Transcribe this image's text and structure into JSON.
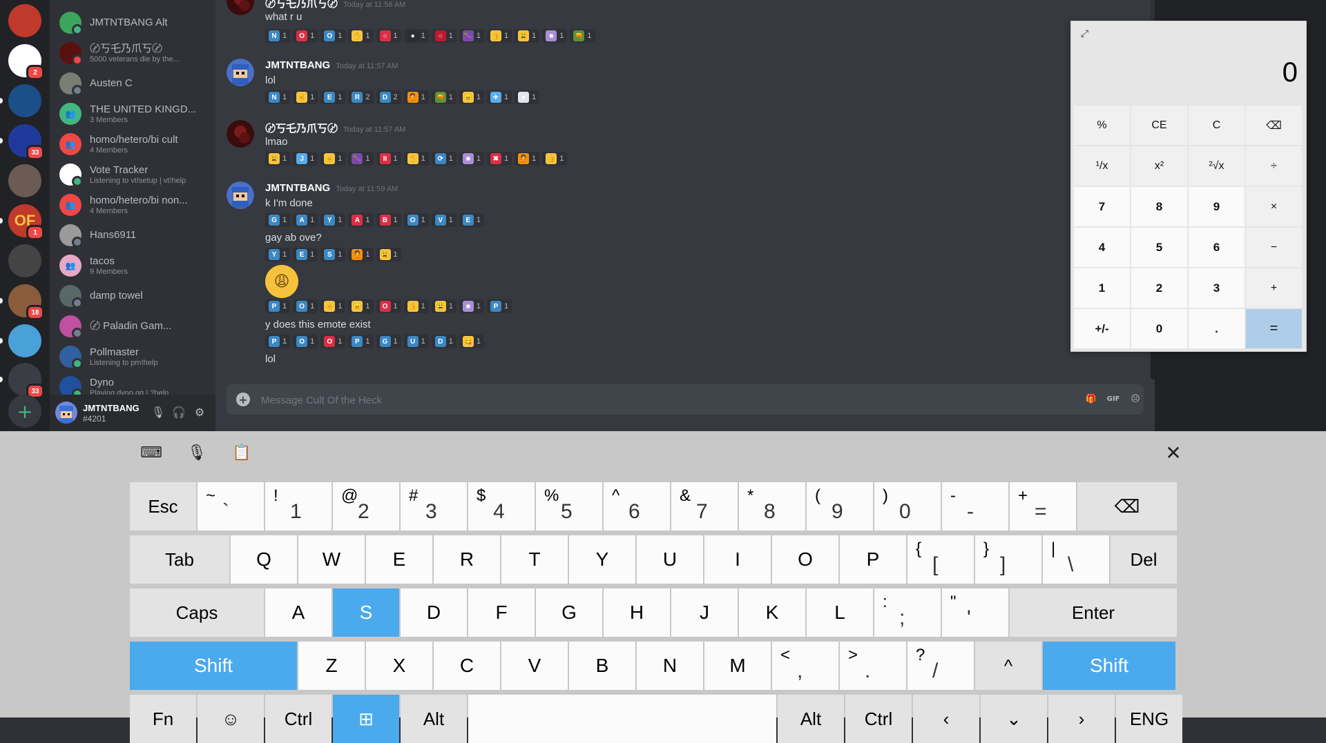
{
  "colors": {
    "accent": "#4ba9ee",
    "discord_dark": "#202225",
    "chat_bg": "#36393f",
    "online": "#43b581",
    "dnd": "#f04747",
    "idle": "#faa61a"
  },
  "rail": {
    "servers": [
      {
        "name": "server-1",
        "color": "#c0392b",
        "badge": ""
      },
      {
        "name": "server-2",
        "color": "#ffffff",
        "badge": "2"
      },
      {
        "name": "rocket-league",
        "color": "#1b4f8a",
        "badge": ""
      },
      {
        "name": "server-galaxy",
        "color": "#203a9c",
        "badge": "33"
      },
      {
        "name": "server-dog",
        "color": "#6b5b52",
        "badge": ""
      },
      {
        "name": "of-server",
        "color": "#c0392b",
        "badge": "1",
        "label": "OF"
      },
      {
        "name": "server-gear",
        "color": "#444444",
        "badge": ""
      },
      {
        "name": "server-face",
        "color": "#8a5c3c",
        "badge": "18"
      },
      {
        "name": "server-gem",
        "color": "#4aa0d8",
        "badge": ""
      },
      {
        "name": "roblox",
        "color": "#3a3d44",
        "badge": "33"
      }
    ]
  },
  "dms": [
    {
      "name": "JMTNTBANG Alt",
      "sub": "",
      "color": "#3ba55c",
      "status": "#43b581"
    },
    {
      "name": "〄丂乇乃爪丂〄",
      "sub": "5000 veterans die by the...",
      "color": "#5a1010",
      "status": "#f04747"
    },
    {
      "name": "Austen C",
      "sub": "",
      "color": "#7a7d72",
      "status": "#747f8d"
    },
    {
      "name": "THE UNITED KINGD...",
      "sub": "3 Members",
      "color": "#43b581",
      "status": ""
    },
    {
      "name": "homo/hetero/bi cult",
      "sub": "4 Members",
      "color": "#f04747",
      "status": ""
    },
    {
      "name": "Vote Tracker",
      "sub": "Listening to vt!setup | vt!help",
      "color": "#ffffff",
      "status": "#43b581"
    },
    {
      "name": "homo/hetero/bi non...",
      "sub": "4 Members",
      "color": "#f04747",
      "status": ""
    },
    {
      "name": "Hans6911",
      "sub": "",
      "color": "#9a9a9a",
      "status": "#747f8d"
    },
    {
      "name": "tacos",
      "sub": "9 Members",
      "color": "#e8a8c8",
      "status": ""
    },
    {
      "name": "damp towel",
      "sub": "",
      "color": "#586868",
      "status": "#747f8d"
    },
    {
      "name": "〄 Paladin Gam...",
      "sub": "",
      "color": "#c050a0",
      "status": "#747f8d"
    },
    {
      "name": "Pollmaster",
      "sub": "Listening to pm!help",
      "color": "#3060a0",
      "status": "#43b581"
    },
    {
      "name": "Dyno",
      "sub": "Playing dyno.gg | ?help",
      "color": "#2050a0",
      "status": "#43b581"
    }
  ],
  "user": {
    "name": "JMTNTBANG",
    "tag": "#4201"
  },
  "messages": {
    "m1": {
      "author": "〄丂乇乃爪丂〄",
      "time": "Today at 11:56 AM",
      "text": "what r u"
    },
    "m2": {
      "author": "JMTNTBANG",
      "time": "Today at 11:57 AM",
      "text": "lol"
    },
    "m3": {
      "author": "〄丂乇乃爪丂〄",
      "time": "Today at 11:57 AM",
      "text": "lmao"
    },
    "m4": {
      "author": "JMTNTBANG",
      "time": "Today at 11:59 AM",
      "text": "k I'm done",
      "text2": "gay ab ove?",
      "text3": "y does this emote exist",
      "text4": "lol"
    }
  },
  "reactions": {
    "r1": [
      [
        "N",
        "1",
        "#3b88c3"
      ],
      [
        "O",
        "1",
        "#dd2e44"
      ],
      [
        "O",
        "1",
        "#3b88c3"
      ],
      [
        "✋",
        "1",
        "#f4c542"
      ],
      [
        "○",
        "1",
        "#dd2e44"
      ],
      [
        "●",
        "1",
        "#292f33"
      ],
      [
        "○",
        "1",
        "#be1931"
      ],
      [
        "🍆",
        "1",
        "#744eaa"
      ],
      [
        "👍",
        "1",
        "#f4c542"
      ],
      [
        "😩",
        "1",
        "#f4c542"
      ],
      [
        "■",
        "1",
        "#aa8ed6"
      ],
      [
        "🔫",
        "1",
        "#5c913b"
      ]
    ],
    "r2": [
      [
        "N",
        "1",
        "#3b88c3"
      ],
      [
        "☝",
        "1",
        "#f4c542"
      ],
      [
        "E",
        "1",
        "#3b88c3"
      ],
      [
        "R",
        "2",
        "#3b88c3"
      ],
      [
        "D",
        "2",
        "#3b88c3"
      ],
      [
        "🙎",
        "1",
        "#f4900c"
      ],
      [
        "🔫",
        "1",
        "#5c913b"
      ],
      [
        "😠",
        "1",
        "#f4c542"
      ],
      [
        "✈",
        "1",
        "#55acee"
      ],
      [
        "●",
        "1",
        "#e1e8ed"
      ]
    ],
    "r3": [
      [
        "😩",
        "1",
        "#f4c542"
      ],
      [
        "J",
        "1",
        "#55acee"
      ],
      [
        "☝",
        "1",
        "#f4c542"
      ],
      [
        "🍆",
        "1",
        "#744eaa"
      ],
      [
        "II",
        "1",
        "#dd2e44"
      ],
      [
        "✋",
        "1",
        "#f4c542"
      ],
      [
        "⟳",
        "1",
        "#3b88c3"
      ],
      [
        "■",
        "1",
        "#aa8ed6"
      ],
      [
        "✖",
        "1",
        "#dd2e44"
      ],
      [
        "🙎",
        "1",
        "#f4900c"
      ],
      [
        "👍",
        "1",
        "#f4c542"
      ]
    ],
    "r4": [
      [
        "G",
        "1",
        "#3b88c3"
      ],
      [
        "A",
        "1",
        "#3b88c3"
      ],
      [
        "Y",
        "1",
        "#3b88c3"
      ],
      [
        "A",
        "1",
        "#dd2e44"
      ],
      [
        "B",
        "1",
        "#dd2e44"
      ],
      [
        "O",
        "1",
        "#3b88c3"
      ],
      [
        "V",
        "1",
        "#3b88c3"
      ],
      [
        "E",
        "1",
        "#3b88c3"
      ]
    ],
    "r5": [
      [
        "Y",
        "1",
        "#3b88c3"
      ],
      [
        "E",
        "1",
        "#3b88c3"
      ],
      [
        "S",
        "1",
        "#3b88c3"
      ],
      [
        "🙎",
        "1",
        "#f4900c"
      ],
      [
        "😩",
        "1",
        "#f4c542"
      ]
    ],
    "r6": [
      [
        "P",
        "1",
        "#3b88c3"
      ],
      [
        "O",
        "1",
        "#3b88c3"
      ],
      [
        "☝",
        "1",
        "#f4c542"
      ],
      [
        "😠",
        "1",
        "#f4c542"
      ],
      [
        "O",
        "1",
        "#dd2e44"
      ],
      [
        "👍",
        "1",
        "#f4c542"
      ],
      [
        "😩",
        "1",
        "#f4c542"
      ],
      [
        "■",
        "1",
        "#aa8ed6"
      ],
      [
        "P",
        "1",
        "#3b88c3"
      ]
    ],
    "r7": [
      [
        "P",
        "1",
        "#3b88c3"
      ],
      [
        "O",
        "1",
        "#3b88c3"
      ],
      [
        "O",
        "1",
        "#dd2e44"
      ],
      [
        "P",
        "1",
        "#3b88c3"
      ],
      [
        "G",
        "1",
        "#3b88c3"
      ],
      [
        "U",
        "1",
        "#3b88c3"
      ],
      [
        "D",
        "1",
        "#3b88c3"
      ],
      [
        "😋",
        "1",
        "#f4c542"
      ]
    ]
  },
  "composer": {
    "placeholder": "Message Cult Of the Heck",
    "gif": "GIF"
  },
  "calc": {
    "display": "0",
    "buttons": [
      [
        "%",
        "CE",
        "C",
        "⌫"
      ],
      [
        "¹/x",
        "x²",
        "²√x",
        "÷"
      ],
      [
        "7",
        "8",
        "9",
        "×"
      ],
      [
        "4",
        "5",
        "6",
        "−"
      ],
      [
        "1",
        "2",
        "3",
        "+"
      ],
      [
        "+/-",
        "0",
        ".",
        "="
      ]
    ]
  },
  "keyboard": {
    "toolbar": {
      "keyboard": "⌨",
      "mic": "🎙",
      "clipboard": "📋",
      "close": "✕"
    },
    "row1": [
      [
        "Esc",
        "",
        ""
      ],
      [
        "",
        "~",
        "`"
      ],
      [
        "",
        "!",
        "1"
      ],
      [
        "",
        "@",
        "2"
      ],
      [
        "",
        "#",
        "3"
      ],
      [
        "",
        "$",
        "4"
      ],
      [
        "",
        "%",
        "5"
      ],
      [
        "",
        "^",
        "6"
      ],
      [
        "",
        "&",
        "7"
      ],
      [
        "",
        "*",
        "8"
      ],
      [
        "",
        "(",
        "9"
      ],
      [
        "",
        ")",
        "0"
      ],
      [
        "",
        "-",
        "-"
      ],
      [
        "",
        "+",
        "="
      ],
      [
        "⌫",
        "",
        ""
      ]
    ],
    "row2": [
      "Tab",
      "Q",
      "W",
      "E",
      "R",
      "T",
      "Y",
      "U",
      "I",
      "O",
      "P",
      [
        "{",
        "["
      ],
      [
        "}",
        "]"
      ],
      [
        "|",
        "\\"
      ],
      "Del"
    ],
    "row3": [
      "Caps",
      "A",
      "S",
      "D",
      "F",
      "G",
      "H",
      "J",
      "K",
      "L",
      [
        ":",
        ";"
      ],
      [
        "\"",
        "'"
      ],
      "Enter"
    ],
    "row4": [
      "Shift",
      "Z",
      "X",
      "C",
      "V",
      "B",
      "N",
      "M",
      [
        "<",
        ","
      ],
      [
        ">",
        "."
      ],
      [
        "?",
        "/"
      ],
      "^",
      "Shift"
    ],
    "row5": [
      "Fn",
      "☺",
      "Ctrl",
      "⊞",
      "Alt",
      "",
      "Alt",
      "Ctrl",
      "‹",
      "⌄",
      "›",
      "ENG"
    ],
    "active_key": "S"
  }
}
